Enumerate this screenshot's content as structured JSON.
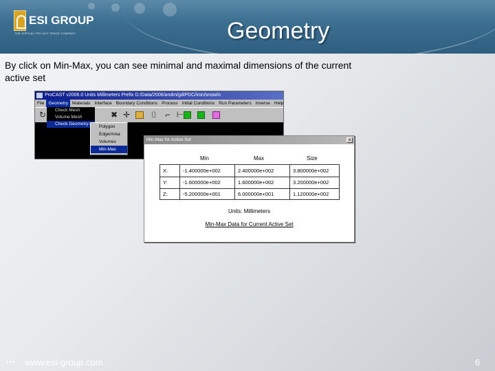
{
  "header": {
    "logo_text": "ESI GROUP",
    "logo_tagline": "THE VIRTUAL TRY-OUT SPACE COMPANY",
    "title": "Geometry"
  },
  "description": "By click on Min-Max, you can see minimal and maximal dimensions of the current active set",
  "app": {
    "window_title": "ProCAST v2006.0   Units  Millimeters  Prefix  D:/Data/2006/andm/gdiPDC/iron/snow/o",
    "menus": [
      "File",
      "Geometry",
      "Materials",
      "Interface",
      "Boundary Conditions",
      "Process",
      "Initial Conditions",
      "Run Parameters",
      "Inverse",
      "Help"
    ],
    "geometry_menu": [
      "Check Mesh",
      "Volume Mesh",
      "Check Geometry"
    ],
    "check_geometry_submenu": [
      "Polygon",
      "Edge/Area",
      "Volumes",
      "Min-Max"
    ],
    "selected_submenu": "Min-Max"
  },
  "dialog": {
    "title": "Min-Max for Active Set",
    "close": "x",
    "columns": [
      "Min",
      "Max",
      "Size"
    ],
    "rows": [
      {
        "axis": "X:",
        "min": "-1.400000e+002",
        "max": "2.400000e+002",
        "size": "3.800000e+002"
      },
      {
        "axis": "Y:",
        "min": "-1.600000e+002",
        "max": "1.600000e+002",
        "size": "3.200000e+002"
      },
      {
        "axis": "Z:",
        "min": "-5.200000e+001",
        "max": "6.000000e+001",
        "size": "1.120000e+002"
      }
    ],
    "units": "Units: Millimeters",
    "caption": "Min-Max Data for Current Active Set"
  },
  "footer": {
    "dots": "•••",
    "url": "www.esi-group.com",
    "page": "6"
  }
}
